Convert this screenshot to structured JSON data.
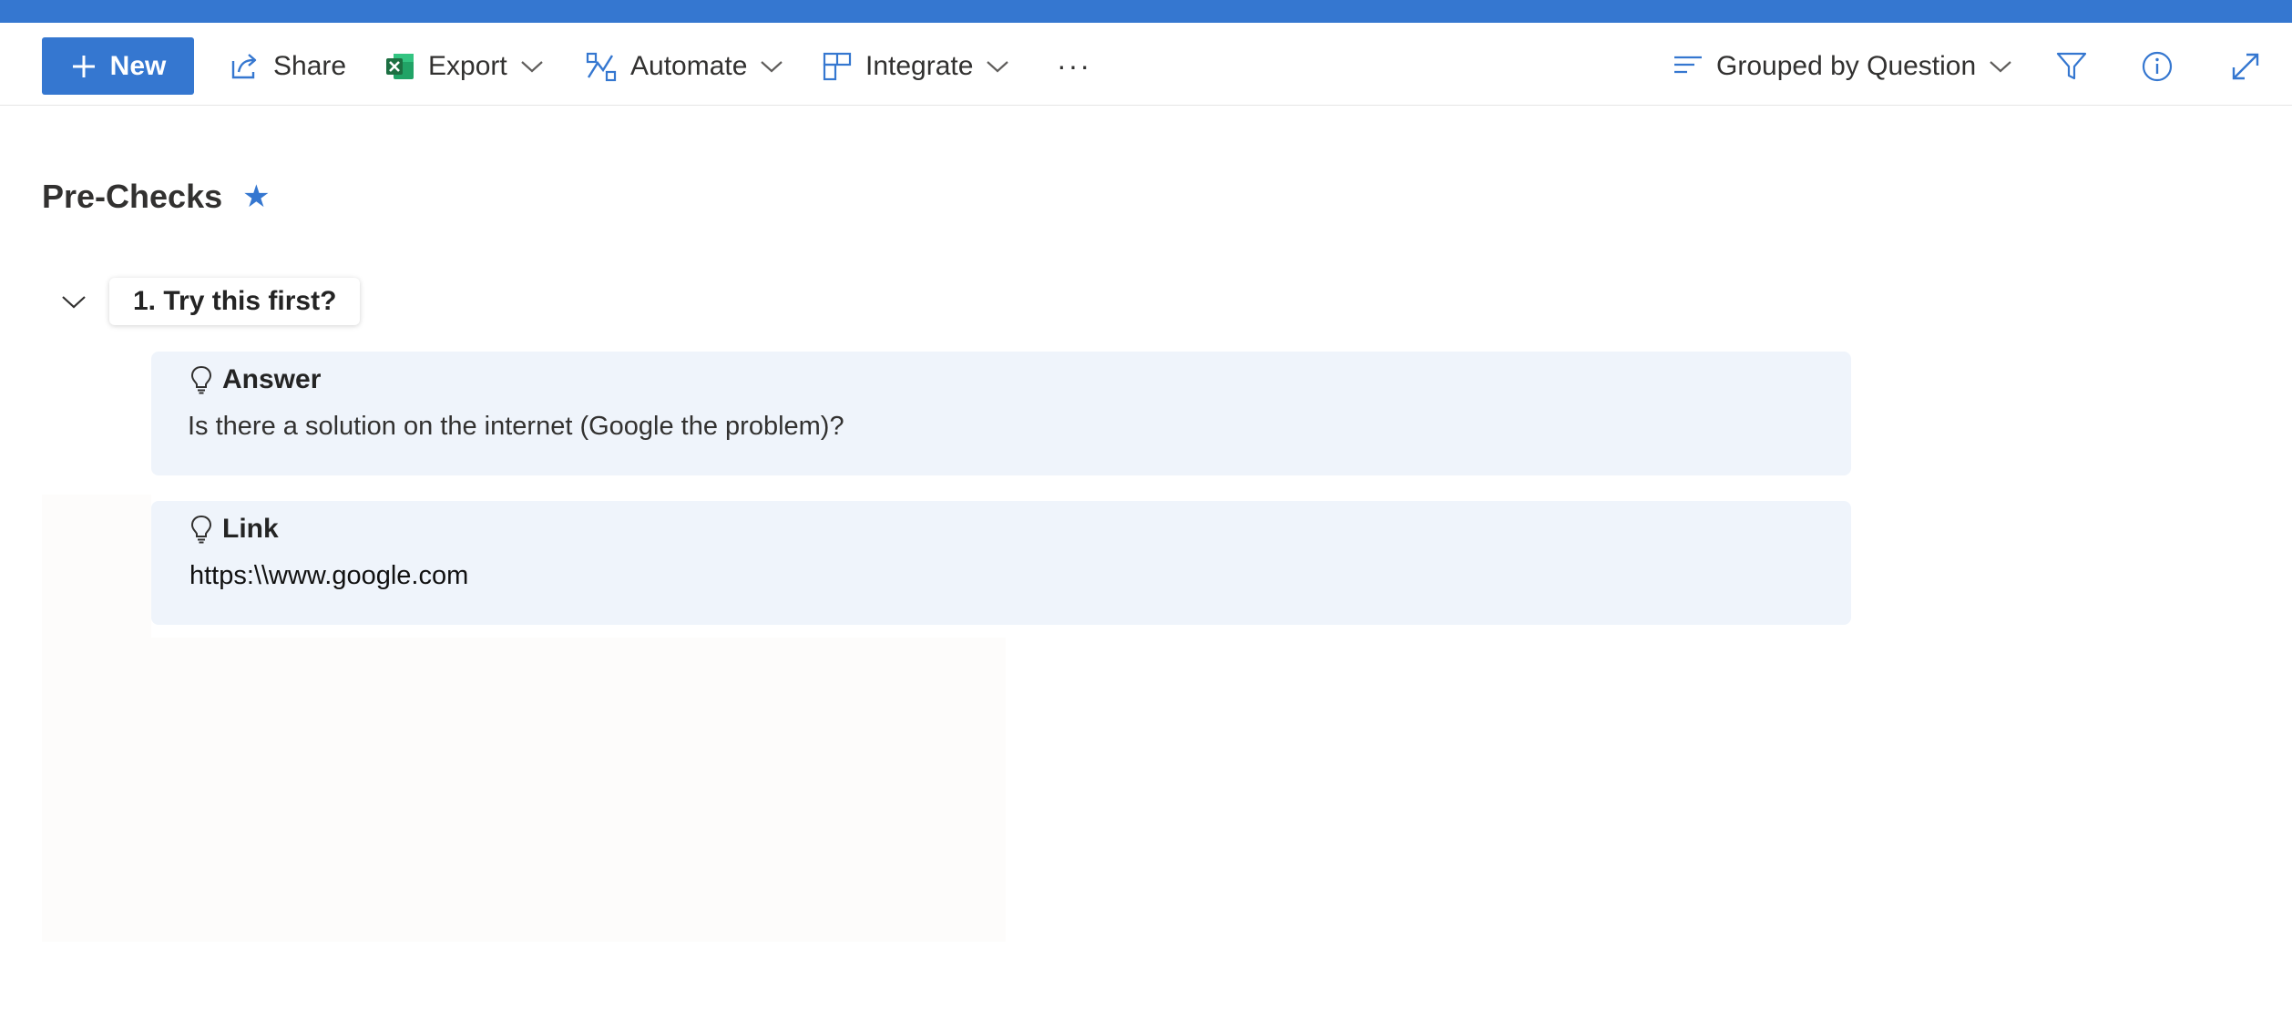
{
  "toolbar": {
    "new_label": "New",
    "share_label": "Share",
    "export_label": "Export",
    "automate_label": "Automate",
    "integrate_label": "Integrate",
    "more_label": "···",
    "grouping_label": "Grouped by Question"
  },
  "page": {
    "title": "Pre-Checks",
    "favorite_icon": "star-icon"
  },
  "group": {
    "label": "1. Try this first?",
    "cards": [
      {
        "heading": "Answer",
        "icon": "lightbulb-icon",
        "text": "Is there a solution on the internet (Google the problem)?"
      },
      {
        "heading": "Link",
        "icon": "lightbulb-icon",
        "text": "https:\\\\www.google.com"
      }
    ]
  },
  "colors": {
    "accent": "#3577d0",
    "card_background": "#eff4fb",
    "excel_green": "#1d6f42"
  }
}
